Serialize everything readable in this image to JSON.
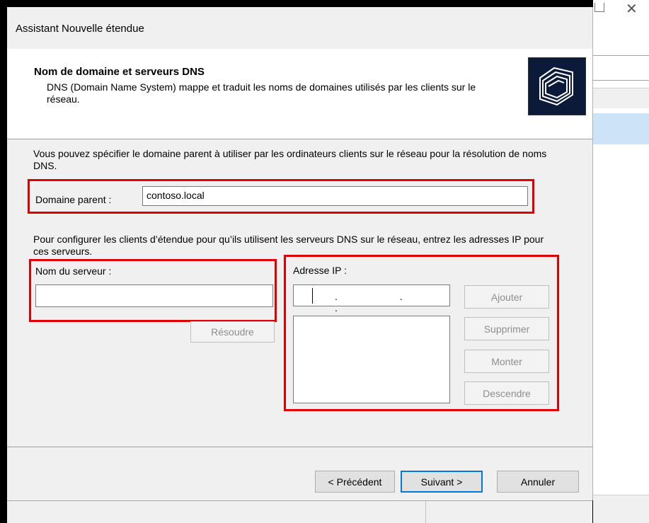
{
  "dialog": {
    "title": "Assistant Nouvelle étendue"
  },
  "header": {
    "title": "Nom de domaine et serveurs DNS",
    "description": "DNS (Domain Name System) mappe et traduit les noms de domaines utilisés par les clients sur le réseau.",
    "icon": "folders-icon"
  },
  "parent_domain": {
    "intro": "Vous pouvez spécifier le domaine parent à utiliser par les ordinateurs clients sur le réseau pour la résolution de noms DNS.",
    "label": "Domaine parent :",
    "value": "contoso.local"
  },
  "dns_servers": {
    "intro": "Pour configurer les clients d’étendue pour qu’ils utilisent les serveurs DNS sur le réseau, entrez les adresses IP pour ces serveurs.",
    "server_name_label": "Nom du serveur :",
    "server_name_value": "",
    "resolve_label": "Résoudre",
    "ip_label": "Adresse IP :",
    "ip_value": ". . .",
    "add_label": "Ajouter",
    "remove_label": "Supprimer",
    "up_label": "Monter",
    "down_label": "Descendre",
    "ip_list": []
  },
  "footer": {
    "back_label": "< Précédent",
    "next_label": "Suivant >",
    "cancel_label": "Annuler"
  },
  "colors": {
    "highlight": "#e00000",
    "focus": "#0078d7"
  }
}
